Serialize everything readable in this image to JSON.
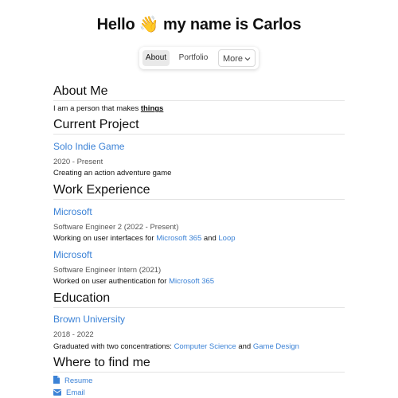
{
  "header": {
    "title_prefix": "Hello",
    "wave_emoji": "👋",
    "title_suffix": "my name is Carlos"
  },
  "nav": {
    "tabs": [
      {
        "label": "About",
        "active": true
      },
      {
        "label": "Portfolio",
        "active": false
      }
    ],
    "more_label": "More"
  },
  "about": {
    "heading": "About Me",
    "text_prefix": "I am a person that makes",
    "text_emphasis": "things"
  },
  "current_project": {
    "heading": "Current Project",
    "name": "Solo Indie Game",
    "dates": "2020 - Present",
    "description": "Creating an action adventure game"
  },
  "work": {
    "heading": "Work Experience",
    "jobs": [
      {
        "company": "Microsoft",
        "role": "Software Engineer 2 (2022 - Present)",
        "desc_prefix": "Working on user interfaces for",
        "link1": "Microsoft 365",
        "conj": "and",
        "link2": "Loop"
      },
      {
        "company": "Microsoft",
        "role": "Software Engineer Intern (2021)",
        "desc_prefix": "Worked on user authentication for",
        "link1": "Microsoft 365"
      }
    ]
  },
  "education": {
    "heading": "Education",
    "school": "Brown University",
    "dates": "2018 - 2022",
    "desc_prefix": "Graduated with two concentrations:",
    "link1": "Computer Science",
    "conj": "and",
    "link2": "Game Design"
  },
  "find_me": {
    "heading": "Where to find me",
    "links": [
      {
        "label": "Resume",
        "icon": "file-icon"
      },
      {
        "label": "Email",
        "icon": "envelope-icon"
      }
    ]
  },
  "colors": {
    "link": "#3b82d6",
    "active_tab_bg": "#e9e9e9"
  }
}
